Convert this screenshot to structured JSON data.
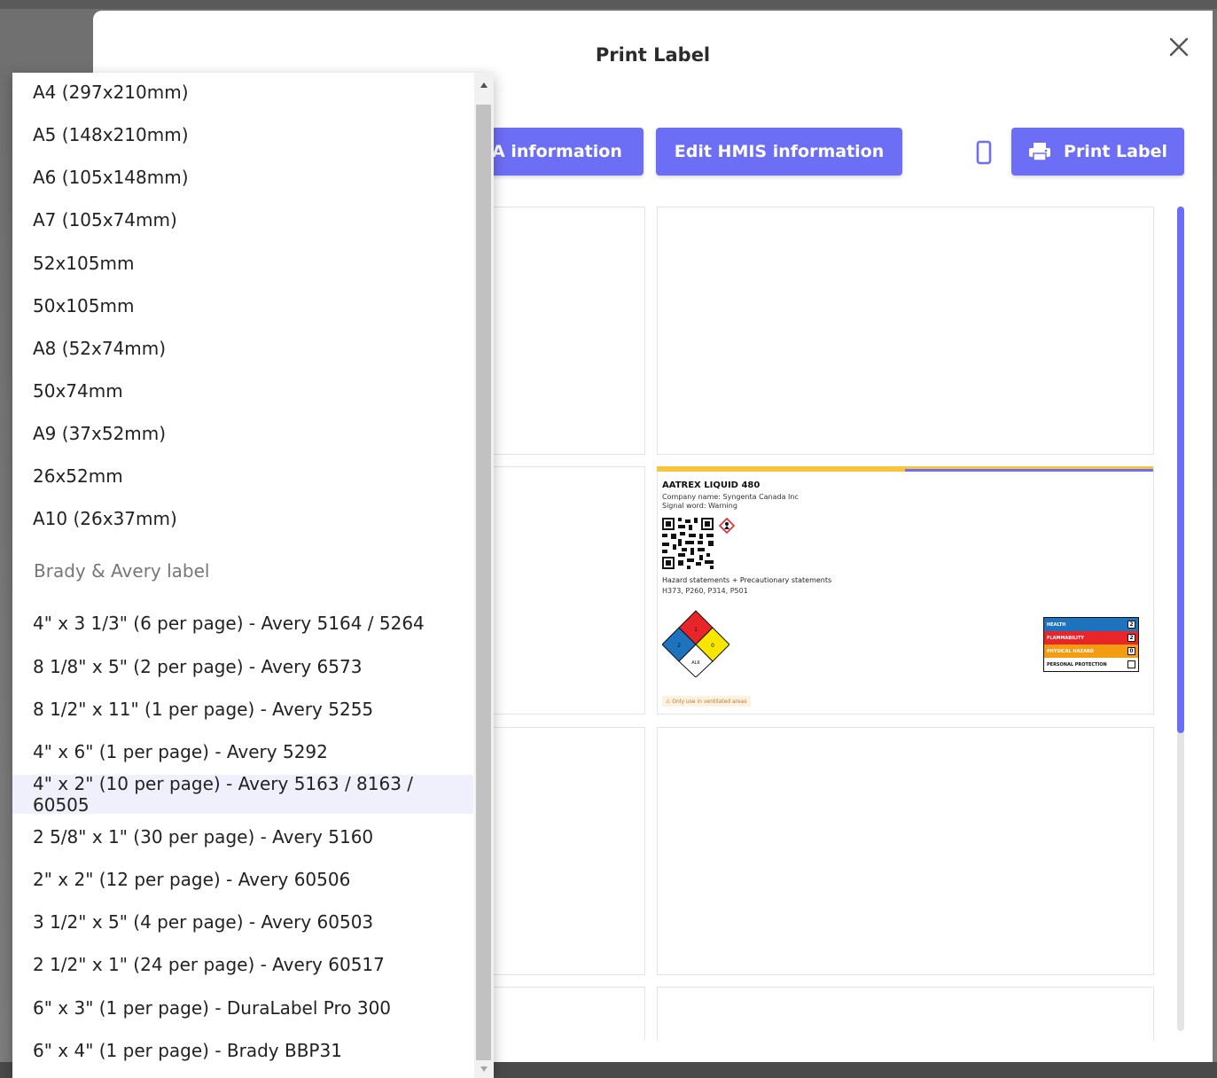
{
  "modal": {
    "title": "Print Label",
    "buttons": {
      "nfpa_label": "A information",
      "hmis_label": "Edit HMIS information",
      "print_label": "Print Label"
    }
  },
  "preview_label": {
    "name": "AATREX LIQUID 480",
    "company": "Company name: Syngenta Canada Inc",
    "signal_word": "Signal word: Warning",
    "hazard_title": "Hazard statements + Precautionary statements",
    "hazard_codes": "H373, P260, P314, P501",
    "nfpa_special": "ALK",
    "hmis_rows": [
      {
        "label": "HEALTH",
        "value": "2",
        "color": "#1e73be"
      },
      {
        "label": "FLAMMABILITY",
        "value": "2",
        "color": "#e8262a"
      },
      {
        "label": "PHYSICAL HAZARD",
        "value": "0",
        "color": "#f39c12"
      },
      {
        "label": "PERSONAL PROTECTION",
        "value": "",
        "color": "#ffffff"
      }
    ],
    "note": "⚠ Only use in ventilated areas"
  },
  "dropdown": {
    "items_a": [
      "A4 (297x210mm)",
      "A5 (148x210mm)",
      "A6 (105x148mm)",
      "A7 (105x74mm)",
      "52x105mm",
      "50x105mm",
      "A8 (52x74mm)",
      "50x74mm",
      "A9 (37x52mm)",
      "26x52mm",
      "A10 (26x37mm)"
    ],
    "group_label": "Brady & Avery label",
    "items_b": [
      "4\" x 3 1/3\" (6 per page) - Avery 5164 / 5264",
      "8 1/8\" x 5\" (2 per page) - Avery 6573",
      "8 1/2\" x 11\" (1 per page) - Avery 5255",
      "4\" x 6\" (1 per page) - Avery 5292",
      "4\" x 2\" (10 per page) - Avery 5163 / 8163 / 60505",
      "2 5/8\" x 1\" (30 per page) - Avery 5160",
      "2\" x 2\" (12 per page) - Avery 60506",
      "3 1/2\" x 5\" (4 per page) - Avery 60503",
      "2 1/2\" x 1\" (24 per page) - Avery 60517",
      "6\" x 3\" (1 per page) - DuraLabel Pro 300",
      "6\" x 4\" (1 per page) - Brady BBP31"
    ],
    "highlighted": "4\" x 2\" (10 per page) - Avery 5163 / 8163 / 60505"
  },
  "colors": {
    "accent": "#6c6ef5",
    "highlight": "#eff0fb"
  }
}
